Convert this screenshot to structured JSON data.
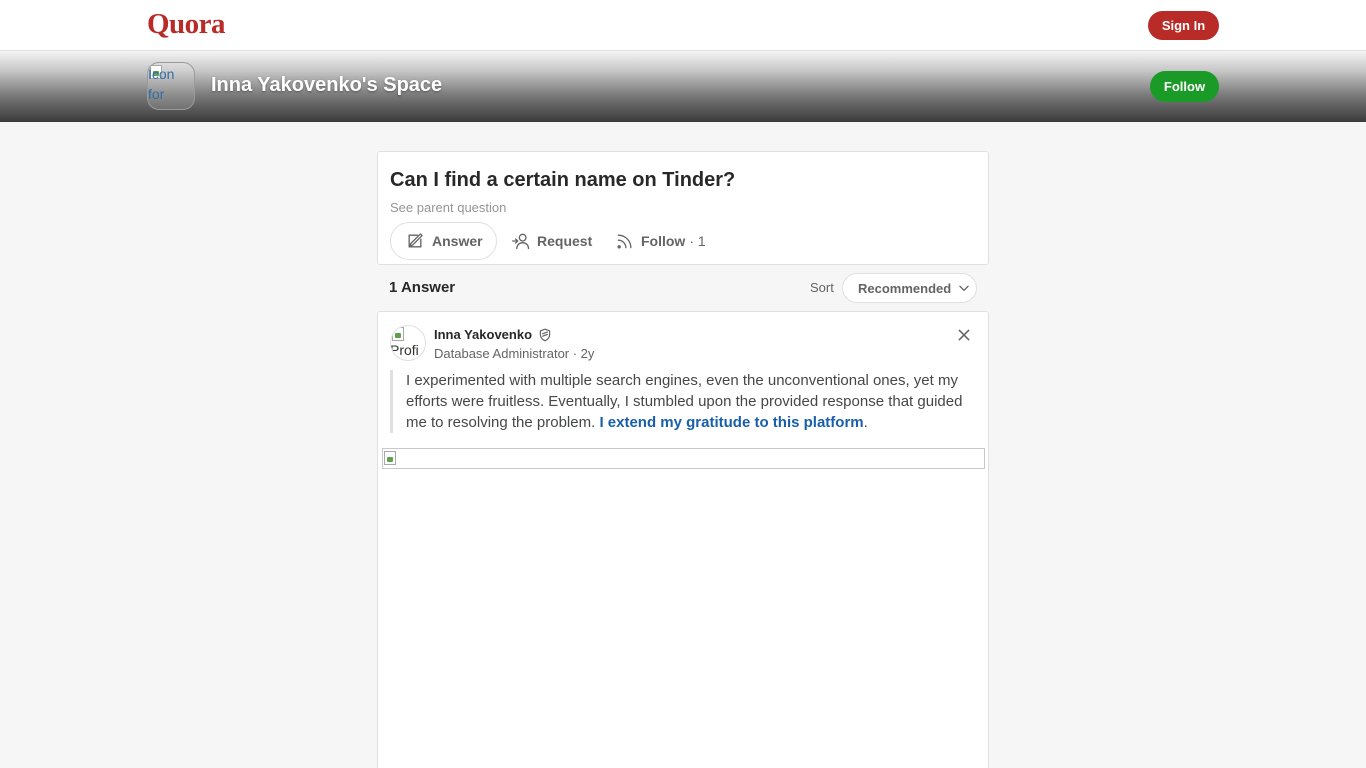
{
  "header": {
    "logo": "Quora",
    "signin_label": "Sign In",
    "brand_color": "#b92b27"
  },
  "space": {
    "icon_alt": "Icon for",
    "title": "Inna Yakovenko's Space",
    "follow_label": "Follow",
    "follow_color": "#1a9a26"
  },
  "question": {
    "title": "Can I find a certain name on Tinder?",
    "parent_link": "See parent question",
    "actions": {
      "answer": "Answer",
      "request": "Request",
      "follow": "Follow",
      "follow_count": "· 1"
    }
  },
  "answers": {
    "count_label": "1 Answer",
    "sort_label": "Sort",
    "sort_value": "Recommended"
  },
  "answer": {
    "avatar_alt": "Profi",
    "author_name": "Inna Yakovenko",
    "author_meta": "Database Administrator · 2y",
    "text": "I experimented with multiple search engines, even the unconventional ones, yet my efforts were fruitless. Eventually, I stumbled upon the provided response that guided me to resolving the problem.",
    "link_text": "I extend my gratitude to this platform",
    "text_end": "."
  }
}
